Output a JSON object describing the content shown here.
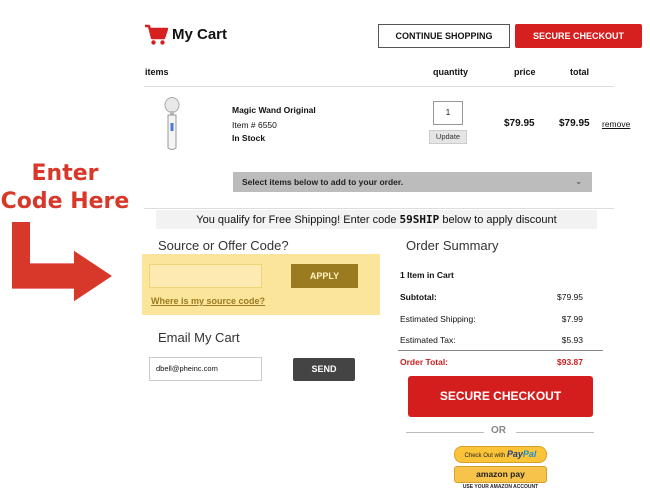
{
  "annotation": {
    "line1": "Enter",
    "line2": "Code Here",
    "color": "#d8382a"
  },
  "header": {
    "title": "My Cart",
    "continue_label": "CONTINUE SHOPPING",
    "checkout_label": "SECURE CHECKOUT",
    "cart_icon": "shopping-cart-icon"
  },
  "table": {
    "headers": {
      "items": "items",
      "quantity": "quantity",
      "price": "price",
      "total": "total"
    }
  },
  "item": {
    "name": "Magic Wand Original",
    "number": "Item # 6550",
    "stock": "In Stock",
    "quantity": "1",
    "update_label": "Update",
    "price": "$79.95",
    "total": "$79.95",
    "remove_label": "remove"
  },
  "addon_select": {
    "label": "Select items below to add to your order."
  },
  "free_shipping": {
    "before": "You qualify for Free Shipping! Enter code ",
    "code": "59SHIP",
    "after": " below to apply discount"
  },
  "source_code": {
    "title": "Source or Offer Code?",
    "value": "",
    "apply_label": "APPLY",
    "help_link": "Where is my source code?"
  },
  "email_cart": {
    "title": "Email My Cart",
    "value": "dbell@pheinc.com",
    "send_label": "SEND"
  },
  "summary": {
    "title": "Order Summary",
    "items_count": "1 Item in Cart",
    "subtotal_label": "Subtotal:",
    "subtotal": "$79.95",
    "shipping_label": "Estimated Shipping:",
    "shipping": "$7.99",
    "tax_label": "Estimated Tax:",
    "tax": "$5.93",
    "total_label": "Order Total:",
    "total": "$93.87",
    "checkout_label": "SECURE CHECKOUT",
    "or_label": "OR",
    "paypal_prefix": "Check Out with",
    "paypal_brand_a": "Pay",
    "paypal_brand_b": "Pal",
    "amazon_label": "amazon pay",
    "amazon_sub": "USE YOUR AMAZON ACCOUNT"
  },
  "colors": {
    "brand_red": "#d61f1f",
    "highlight_yellow": "#fbe59a",
    "apply_gold": "#9b7b20"
  }
}
